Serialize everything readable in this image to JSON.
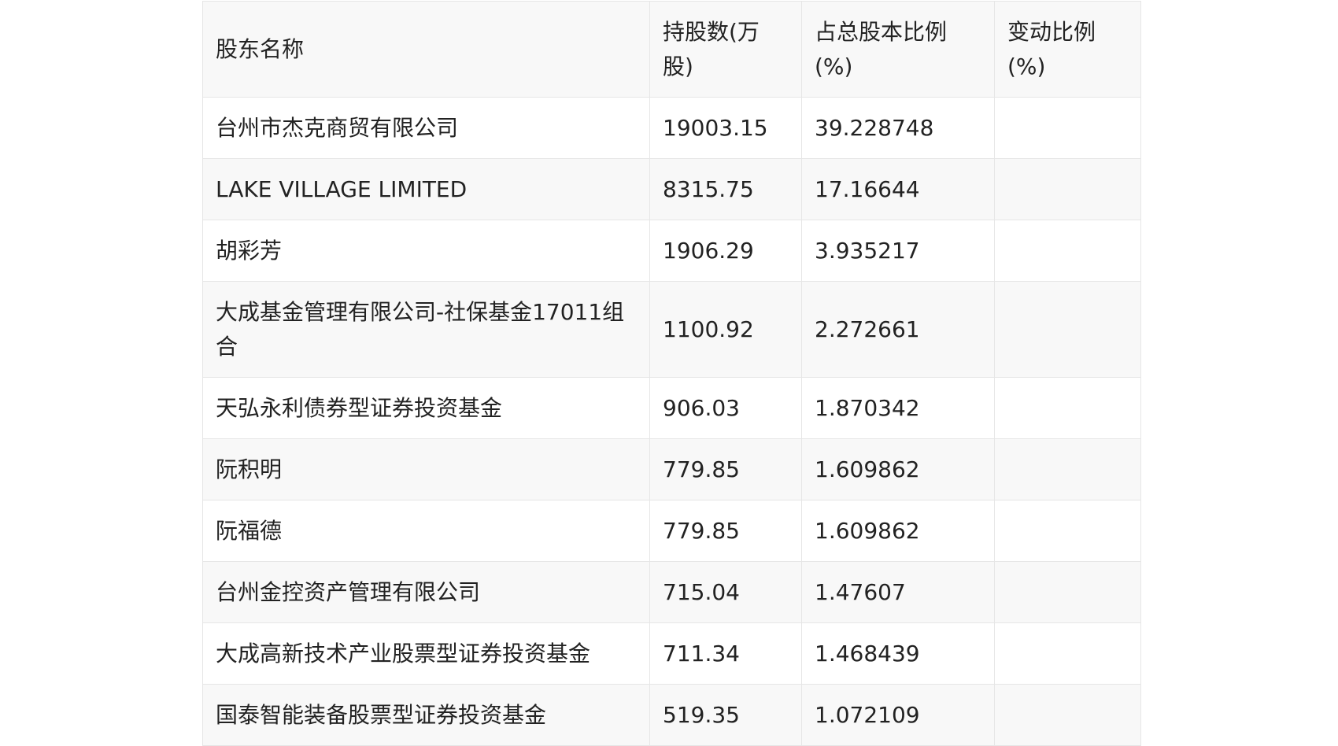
{
  "table": {
    "headers": {
      "name": "股东名称",
      "shares": "持股数(万股)",
      "pct": "占总股本比例(%)",
      "change": "变动比例(%)"
    },
    "rows": [
      {
        "name": "台州市杰克商贸有限公司",
        "shares": "19003.15",
        "pct": "39.228748",
        "change": ""
      },
      {
        "name": "LAKE VILLAGE LIMITED",
        "shares": "8315.75",
        "pct": "17.16644",
        "change": ""
      },
      {
        "name": "胡彩芳",
        "shares": "1906.29",
        "pct": "3.935217",
        "change": ""
      },
      {
        "name": "大成基金管理有限公司-社保基金17011组合",
        "shares": "1100.92",
        "pct": "2.272661",
        "change": ""
      },
      {
        "name": "天弘永利债券型证券投资基金",
        "shares": "906.03",
        "pct": "1.870342",
        "change": ""
      },
      {
        "name": "阮积明",
        "shares": "779.85",
        "pct": "1.609862",
        "change": ""
      },
      {
        "name": "阮福德",
        "shares": "779.85",
        "pct": "1.609862",
        "change": ""
      },
      {
        "name": "台州金控资产管理有限公司",
        "shares": "715.04",
        "pct": "1.47607",
        "change": ""
      },
      {
        "name": "大成高新技术产业股票型证券投资基金",
        "shares": "711.34",
        "pct": "1.468439",
        "change": ""
      },
      {
        "name": "国泰智能装备股票型证券投资基金",
        "shares": "519.35",
        "pct": "1.072109",
        "change": ""
      }
    ]
  }
}
